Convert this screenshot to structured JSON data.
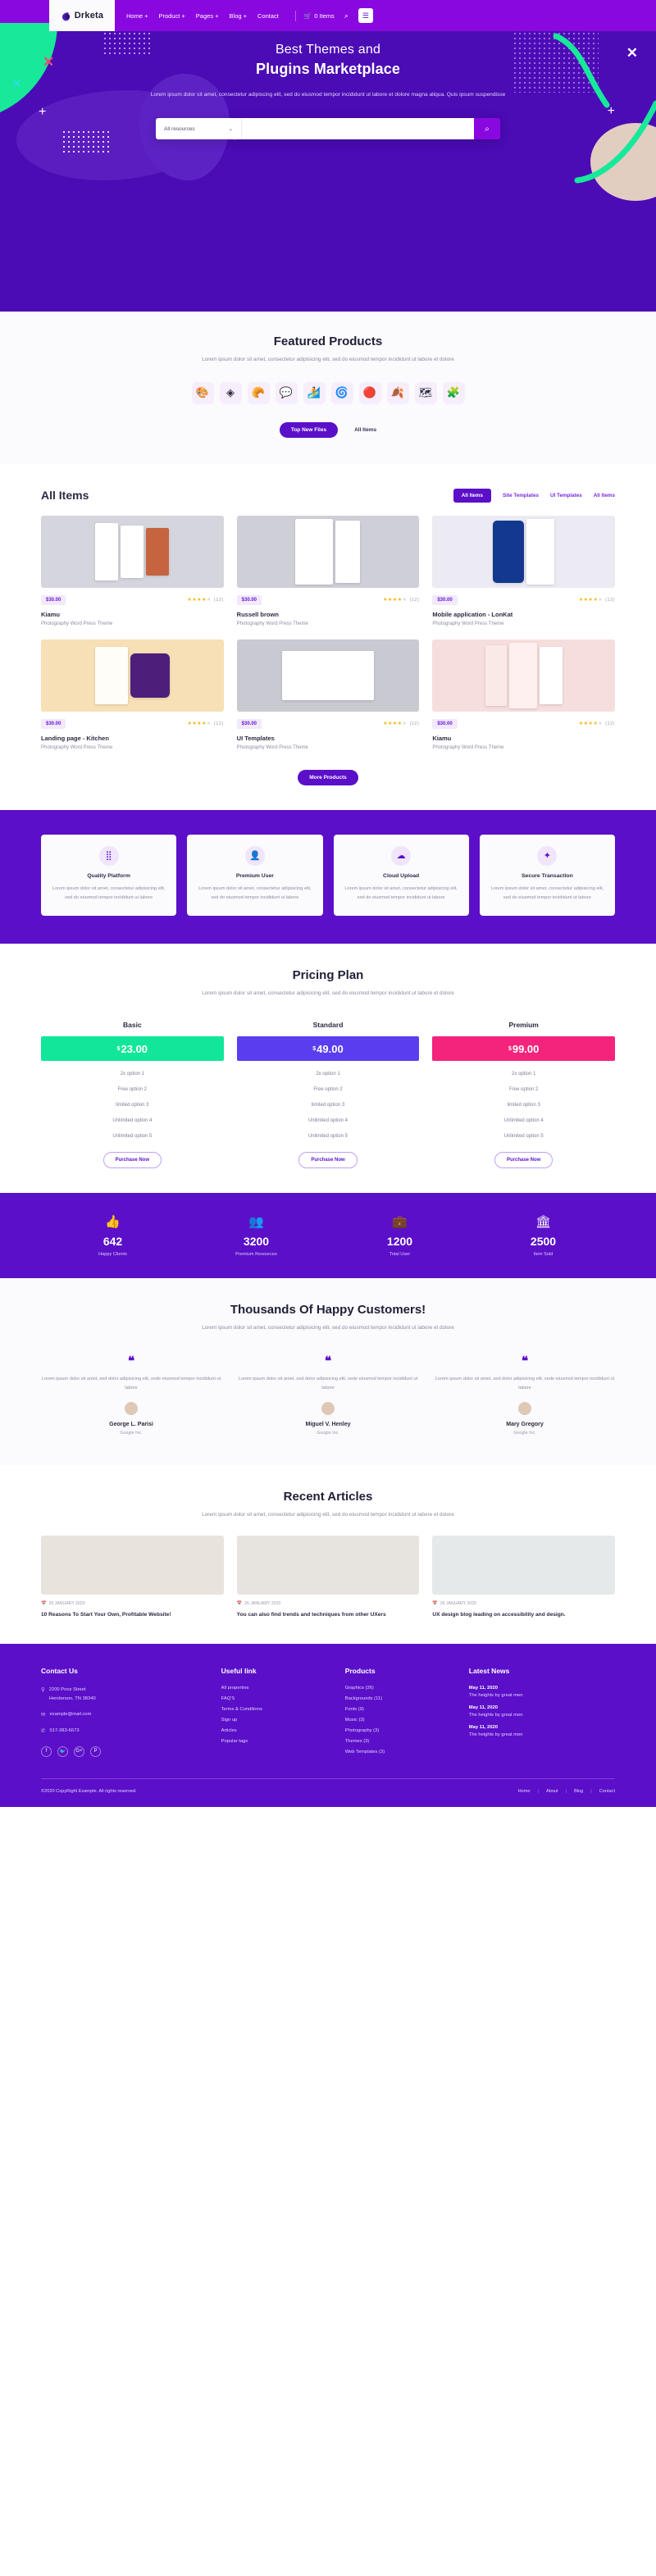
{
  "brand": {
    "name": "Drketa",
    "logo_icon": "leaf-logo-icon"
  },
  "nav": {
    "links": [
      "Home +",
      "Product +",
      "Pages +",
      "Blog +",
      "Contact"
    ],
    "cart_label": "0 Items",
    "cart_icon": "cart-icon",
    "search_icon": "search-icon",
    "menu_icon": "hamburger-icon"
  },
  "hero": {
    "title_line1": "Best Themes and",
    "title_line2": "Plugins Marketplace",
    "paragraph": "Lorem ipsum dolor sit amet, consectetur adipiscing elit, sed do eiusmod tempor incididunt ut labore et dolore magna aliqua. Quis ipsum suspendisse",
    "search": {
      "category": "All resources",
      "placeholder": "",
      "value": "",
      "chevron_icon": "chevron-down-icon",
      "button_icon": "search-icon"
    }
  },
  "featured": {
    "title": "Featured Products",
    "subtitle": "Lorem ipsum dolor sit amet, consectetur adipisicing elit, sed do eiusmod tempor incididunt ut labore et dolore",
    "icons": [
      "🎨",
      "◈",
      "🥐",
      "💬",
      "🏄",
      "🌀",
      "🔴",
      "🍂",
      "🗺",
      "🧩"
    ],
    "primary_button": "Top New Files",
    "secondary_button": "All Items"
  },
  "all_items": {
    "title": "All Items",
    "filters": [
      "All Items",
      "Site Templates",
      "UI Templates",
      "All Items"
    ],
    "active_filter": 0,
    "more_button": "More Products",
    "cards": [
      {
        "price": "$30.00",
        "rating": 4,
        "reviews": "(12)",
        "title": "Kiamu",
        "subtitle": "Photography Word Press Theme",
        "bg": "#d5d5dd"
      },
      {
        "price": "$30.00",
        "rating": 4,
        "reviews": "(12)",
        "title": "Russell brown",
        "subtitle": "Photography Word Press Theme",
        "bg": "#cfcfd7"
      },
      {
        "price": "$30.00",
        "rating": 4,
        "reviews": "(12)",
        "title": "Mobile application - LonKat",
        "subtitle": "Photography Word Press Theme",
        "bg": "#eceaf2"
      },
      {
        "price": "$30.00",
        "rating": 4,
        "reviews": "(12)",
        "title": "Landing page - Kitchen",
        "subtitle": "Photography Word Press Theme",
        "bg": "#f7dfb6"
      },
      {
        "price": "$30.00",
        "rating": 4,
        "reviews": "(12)",
        "title": "UI Templates",
        "subtitle": "Photography Word Press Theme",
        "bg": "#c9c9d1"
      },
      {
        "price": "$30.00",
        "rating": 4,
        "reviews": "(12)",
        "title": "Kiamu",
        "subtitle": "Photography Word Press Theme",
        "bg": "#f6dedd"
      }
    ]
  },
  "features": [
    {
      "icon": "network-nodes-icon",
      "glyph": "⣿",
      "title": "Quality Platform",
      "text": "Lorem ipsum dolor sit amet, consectetur adipisicing elit, sed do eiusmod tempor incididunt ut labore"
    },
    {
      "icon": "user-shield-icon",
      "glyph": "👤",
      "title": "Premium User",
      "text": "Lorem ipsum dolor sit amet, consectetur adipisicing elit, sed do eiusmod tempor incididunt ut labore"
    },
    {
      "icon": "cloud-upload-icon",
      "glyph": "☁",
      "title": "Cloud Upload",
      "text": "Lorem ipsum dolor sit amet, consectetur adipisicing elit, sed do eiusmod tempor incididunt ut labore"
    },
    {
      "icon": "secure-network-icon",
      "glyph": "✦",
      "title": "Secure Transaction",
      "text": "Lorem ipsum dolor sit amet, consectetur adipisicing elit, sed do eiusmod tempor incididunt ut labore"
    }
  ],
  "pricing": {
    "title": "Pricing Plan",
    "subtitle": "Lorem ipsum dolor sit amet, consectetur adipisicing elit, sed do eiusmod tempor incididunt ut labore et dolore",
    "plans": [
      {
        "name": "Basic",
        "currency": "$",
        "amount": "23.00",
        "color": "#12e69a",
        "features": [
          "2x option 1",
          "Free option 2",
          "limited option 3",
          "Unlimited option 4",
          "Unlimited option 5"
        ],
        "button": "Purchase Now"
      },
      {
        "name": "Standard",
        "currency": "$",
        "amount": "49.00",
        "color": "#5b3df0",
        "features": [
          "2x option 1",
          "Free option 2",
          "limited option 3",
          "Unlimited option 4",
          "Unlimited option 5"
        ],
        "button": "Purchase Now"
      },
      {
        "name": "Premium",
        "currency": "$",
        "amount": "99.00",
        "color": "#f4247c",
        "features": [
          "2x option 1",
          "Free option 2",
          "limited option 3",
          "Unlimited option 4",
          "Unlimited option 5"
        ],
        "button": "Purchase Now"
      }
    ]
  },
  "stats": [
    {
      "icon": "thumbs-up-icon",
      "glyph": "👍",
      "number": "642",
      "label": "Happy Clients"
    },
    {
      "icon": "users-icon",
      "glyph": "👥",
      "number": "3200",
      "label": "Premium Resources"
    },
    {
      "icon": "briefcase-icon",
      "glyph": "💼",
      "number": "1200",
      "label": "Total User"
    },
    {
      "icon": "building-icon",
      "glyph": "🏛",
      "number": "2500",
      "label": "Item Sold"
    }
  ],
  "testimonials": {
    "title": "Thousands Of Happy Customers!",
    "subtitle": "Lorem ipsum dolor sit amet, consectetur adipisicing elit, sed do eiusmod tempor incididunt ut labore et dolore",
    "items": [
      {
        "quote_icon": "quote-icon",
        "text": "Lorem ipsum dolor sit amet, sed dolor adipisicing elit, sede eiusmod tempor incididunt ut labore",
        "name": "George L. Parisi",
        "role": "Google Inc."
      },
      {
        "quote_icon": "quote-icon",
        "text": "Lorem ipsum dolor sit amet, sed dolor adipisicing elit, sede eiusmod tempor incididunt ut labore",
        "name": "Miguel V. Henley",
        "role": "Google Inc."
      },
      {
        "quote_icon": "quote-icon",
        "text": "Lorem ipsum dolor sit amet, sed dolor adipisicing elit, sede eiusmod tempor incididunt ut labore",
        "name": "Mary Gregory",
        "role": "Google Inc."
      }
    ]
  },
  "articles": {
    "title": "Recent Articles",
    "subtitle": "Lorem ipsum dolor sit amet, consectetur adipisicing elit, sed do eiusmod tempor incididunt ut labore et dolore",
    "items": [
      {
        "date": "26 JANUARY 2020",
        "date_icon": "calendar-icon",
        "title": "10 Reasons To Start Your Own, Profitable Website!",
        "bg": "#e8e3dc"
      },
      {
        "date": "26 JANUARY 2020",
        "date_icon": "calendar-icon",
        "title": "You can also find trends and techniques from other UXers",
        "bg": "#e7e4e0"
      },
      {
        "date": "26 JANUARY 2020",
        "date_icon": "calendar-icon",
        "title": "UX design blog leading on accessibility and design.",
        "bg": "#e6e9ea"
      }
    ]
  },
  "footer": {
    "contact": {
      "heading": "Contact Us",
      "address_icon": "location-pin-icon",
      "address_line1": "2200 Pooz Street",
      "address_line2": "Henderson, TN 38340",
      "email_icon": "envelope-icon",
      "email": "example@mail.com",
      "phone_icon": "phone-icon",
      "phone": "517-383-6673",
      "socials": [
        {
          "icon": "facebook-icon",
          "glyph": "f"
        },
        {
          "icon": "twitter-icon",
          "glyph": "🐦"
        },
        {
          "icon": "google-plus-icon",
          "glyph": "G+"
        },
        {
          "icon": "pinterest-icon",
          "glyph": "P"
        }
      ]
    },
    "useful": {
      "heading": "Useful link",
      "links": [
        "All properties",
        "FAQ'S",
        "Terms & Conditions",
        "Sign up",
        "Articles",
        "Popular tags"
      ]
    },
    "products": {
      "heading": "Products",
      "links": [
        "Graphics (26)",
        "Backgrounds (11)",
        "Fonts (9)",
        "Music (3)",
        "Photography (3)",
        "Themes (3)",
        "Web Templates (3)"
      ]
    },
    "news": {
      "heading": "Latest News",
      "items": [
        {
          "date": "May 11, 2020",
          "title": "The heights by great men"
        },
        {
          "date": "May 11, 2020",
          "title": "The heights by great men"
        },
        {
          "date": "May 11, 2020",
          "title": "The heights by great men"
        }
      ]
    },
    "copyright": "©2020 CopyRight Example. All rights reserved.",
    "bottom_links": [
      "Home",
      "About",
      "Blog",
      "Contact"
    ]
  },
  "colors": {
    "primary": "#5b0fc9",
    "accent": "#8a08e0",
    "green": "#12e69a",
    "pink": "#f4247c"
  }
}
